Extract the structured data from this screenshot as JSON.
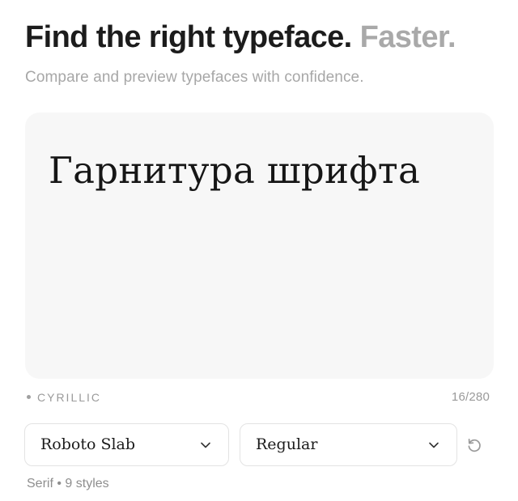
{
  "header": {
    "title_main": "Find the right typeface.",
    "title_accent": "Faster.",
    "subtitle": "Compare and preview typefaces with confidence."
  },
  "preview": {
    "text": "Гарнитура шрифта",
    "script_label": "CYRILLIC",
    "char_count": "16/280"
  },
  "controls": {
    "font_family": "Roboto Slab",
    "font_style": "Regular",
    "chevron_icon": "chevron-down-icon",
    "reset_icon": "reset-icon"
  },
  "font_info": {
    "category": "Serif",
    "separator": "•",
    "styles": "9 styles"
  },
  "colors": {
    "text": "#1c1c1c",
    "muted": "#a9a9a9",
    "card_bg": "#f7f7f7",
    "border": "#e3e3e3"
  }
}
